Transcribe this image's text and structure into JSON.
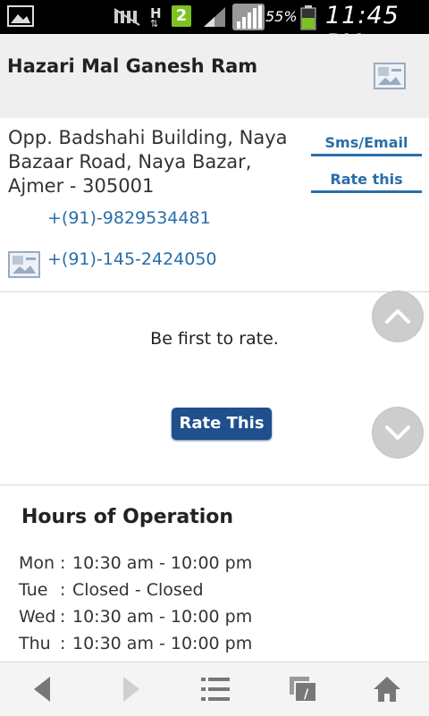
{
  "status_bar": {
    "network_type": "H",
    "notification_count": "2",
    "battery_percent": "55%",
    "time": "11:45 PM"
  },
  "header": {
    "title": "Hazari Mal Ganesh Ram",
    "image_icon": "picture-icon"
  },
  "contact": {
    "address_lines": [
      "Opp. Badshahi Building, Naya",
      "Bazaar Road, Naya Bazar,",
      "Ajmer - 305001"
    ],
    "phones": [
      "+(91)-9829534481",
      "+(91)-145-2424050"
    ],
    "sms_label": "Sms/Email",
    "rate_label": "Rate this"
  },
  "rating": {
    "prompt": "Be first to rate.",
    "button_label": "Rate This"
  },
  "hours": {
    "title": "Hours of Operation",
    "rows": [
      {
        "day": "Mon",
        "sep": ":",
        "time": "10:30 am - 10:00 pm"
      },
      {
        "day": "Tue",
        "sep": ":",
        "time": "Closed - Closed"
      },
      {
        "day": "Wed",
        "sep": ":",
        "time": "10:30 am - 10:00 pm"
      },
      {
        "day": "Thu",
        "sep": ":",
        "time": "10:30 am - 10:00 pm"
      }
    ]
  },
  "colors": {
    "link_blue": "#2a6ea8",
    "button_blue": "#1f4f8c",
    "header_bg": "#efefef"
  },
  "bottom_nav": [
    "back-icon",
    "forward-icon",
    "menu-list-icon",
    "tabs-icon",
    "home-icon"
  ]
}
